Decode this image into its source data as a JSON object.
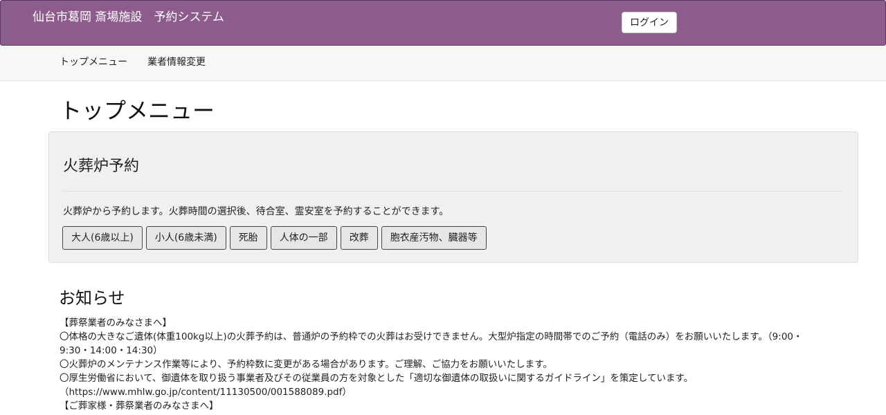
{
  "header": {
    "title": "仙台市葛岡 斎場施設　予約システム",
    "login_label": "ログイン",
    "background_color": "#8c5d8c"
  },
  "subnav": {
    "items": [
      {
        "label": "トップメニュー"
      },
      {
        "label": "業者情報変更"
      }
    ]
  },
  "main": {
    "page_title": "トップメニュー",
    "panel": {
      "title": "火葬炉予約",
      "description": "火葬炉から予約します。火葬時間の選択後、待合室、霊安室を予約することができます。",
      "buttons": [
        {
          "label": "大人(6歳以上)"
        },
        {
          "label": "小人(6歳未満)"
        },
        {
          "label": "死胎"
        },
        {
          "label": "人体の一部"
        },
        {
          "label": "改葬"
        },
        {
          "label": "胞衣産汚物、臓器等"
        }
      ]
    },
    "notices": {
      "title": "お知らせ",
      "lines": [
        "【葬祭業者のみなさまへ】",
        "〇体格の大きなご遺体(体重100kg以上)の火葬予約は、普通炉の予約枠での火葬はお受けできません。大型炉指定の時間帯でのご予約（電話のみ）をお願いいたします。（9:00・",
        "9:30・14:00・14:30）",
        "〇火葬炉のメンテナンス作業等により、予約枠数に変更がある場合があります。ご理解、ご協力をお願いいたします。",
        "〇厚生労働省において、御遺体を取り扱う事業者及びその従業員の方を対象とした「適切な御遺体の取扱いに関するガイドライン」を策定しています。",
        "（https://www.mhlw.go.jp/content/11130500/001588089.pdf）",
        "【ご葬家様・葬祭業者のみなさまへ】"
      ]
    }
  }
}
